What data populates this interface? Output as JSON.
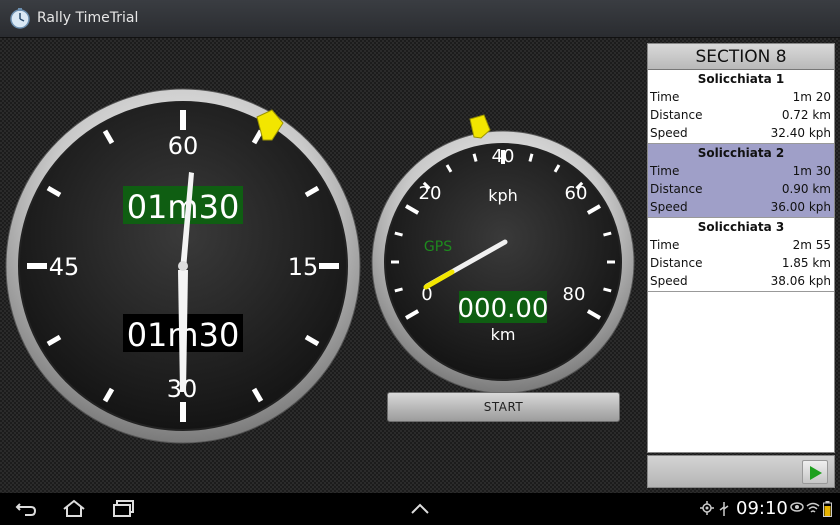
{
  "app": {
    "title": "Rally TimeTrial"
  },
  "stopwatch": {
    "dial_labels": {
      "top": "60",
      "right": "15",
      "bottom": "30",
      "left": "45"
    },
    "upper_display": "01m30",
    "lower_display": "01m30"
  },
  "speedometer": {
    "dial_labels": [
      "0",
      "20",
      "40",
      "60",
      "80"
    ],
    "unit": "kph",
    "gps_label": "GPS",
    "distance_display": "000.00",
    "distance_unit": "km"
  },
  "start_button": {
    "label": "START"
  },
  "section": {
    "title": "SECTION 8",
    "segments": [
      {
        "name": "Solicchiata 1",
        "active": false,
        "rows": [
          {
            "label": "Time",
            "value": "1m 20"
          },
          {
            "label": "Distance",
            "value": "0.72 km"
          },
          {
            "label": "Speed",
            "value": "32.40 kph"
          }
        ]
      },
      {
        "name": "Solicchiata 2",
        "active": true,
        "rows": [
          {
            "label": "Time",
            "value": "1m 30"
          },
          {
            "label": "Distance",
            "value": "0.90 km"
          },
          {
            "label": "Speed",
            "value": "36.00 kph"
          }
        ]
      },
      {
        "name": "Solicchiata 3",
        "active": false,
        "rows": [
          {
            "label": "Time",
            "value": "2m 55"
          },
          {
            "label": "Distance",
            "value": "1.85 km"
          },
          {
            "label": "Speed",
            "value": "38.06 kph"
          }
        ]
      }
    ]
  },
  "statusbar": {
    "time": "09:10"
  },
  "colors": {
    "display_green": "#0f5e12",
    "marker_yellow": "#f2e600",
    "active_row": "#9f9fc8"
  }
}
